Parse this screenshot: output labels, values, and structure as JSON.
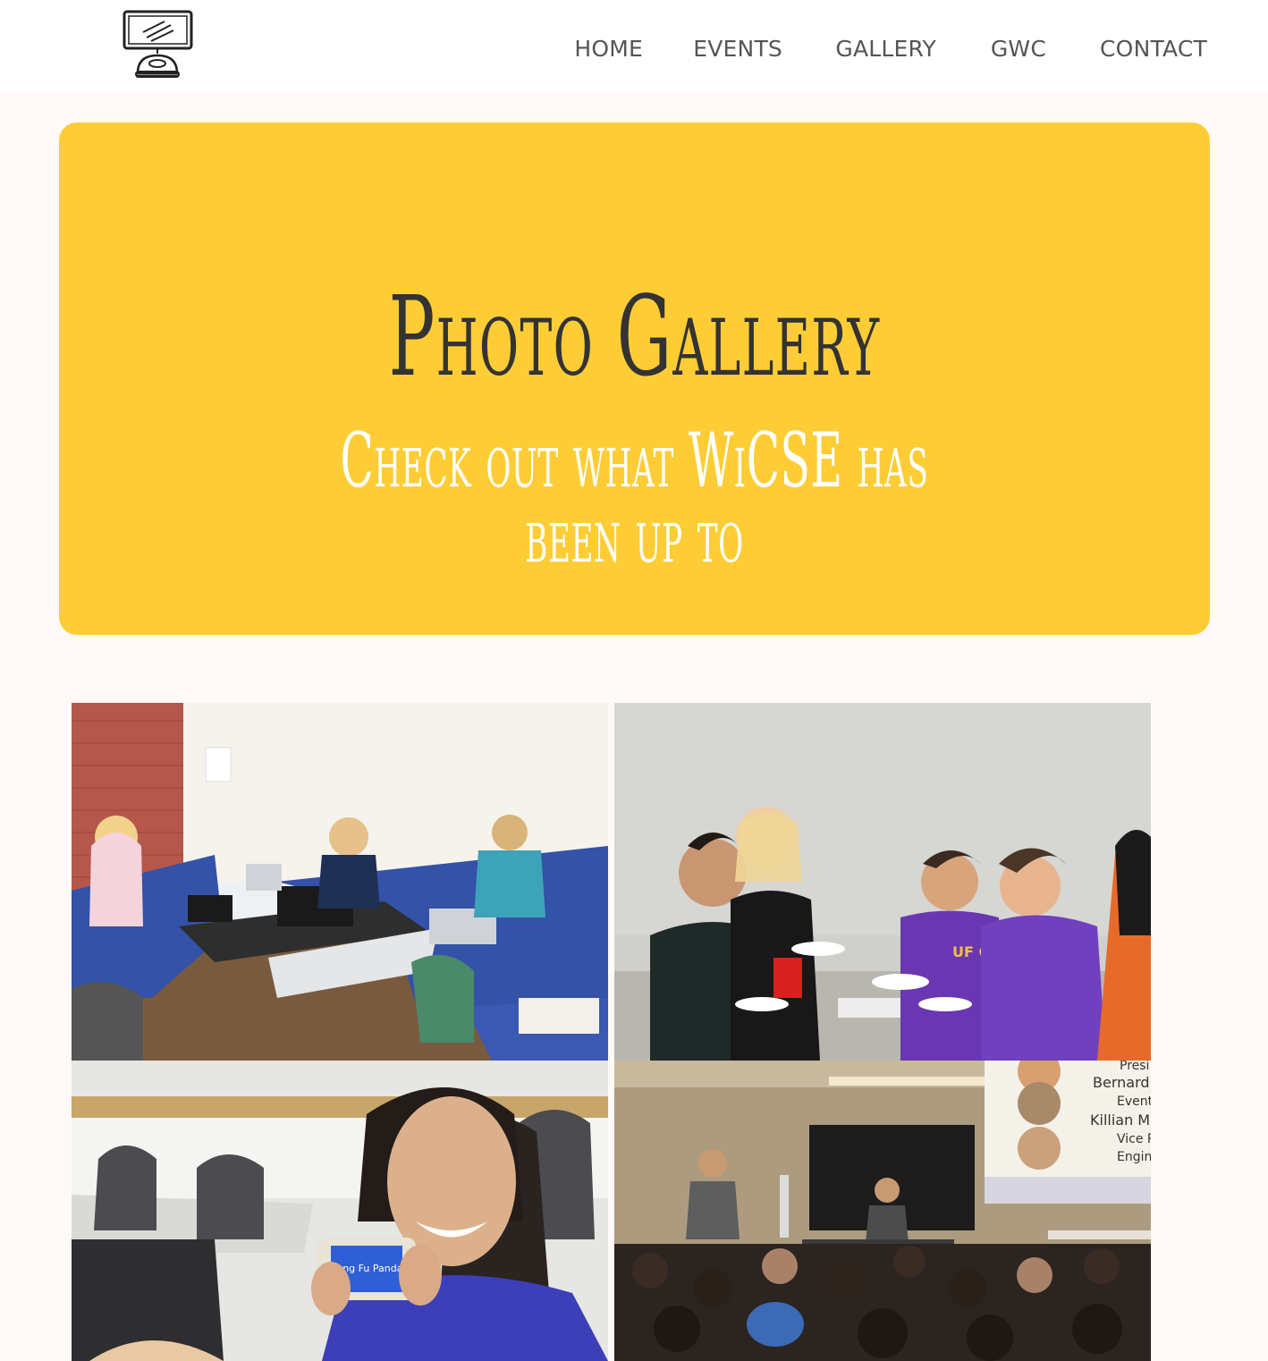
{
  "nav": {
    "home": "HOME",
    "events": "EVENTS",
    "gallery": "GALLERY",
    "gwc": "GWC",
    "contact": "CONTACT"
  },
  "hero": {
    "title": "Photo Gallery",
    "subtitle": "Check out what WiCSE has been up to"
  },
  "gallery": {
    "photo_texts": {
      "shirt_text": "UF GK",
      "phone_text": "Kung Fu Panda",
      "slide_lines": [
        "Presi",
        "Bernard",
        "Event",
        "Killian M",
        "Vice P",
        "Engin"
      ]
    }
  },
  "colors": {
    "hero_bg": "#fecd35",
    "title": "#333333",
    "subtitle": "#ffffff",
    "nav_text": "#555555"
  }
}
